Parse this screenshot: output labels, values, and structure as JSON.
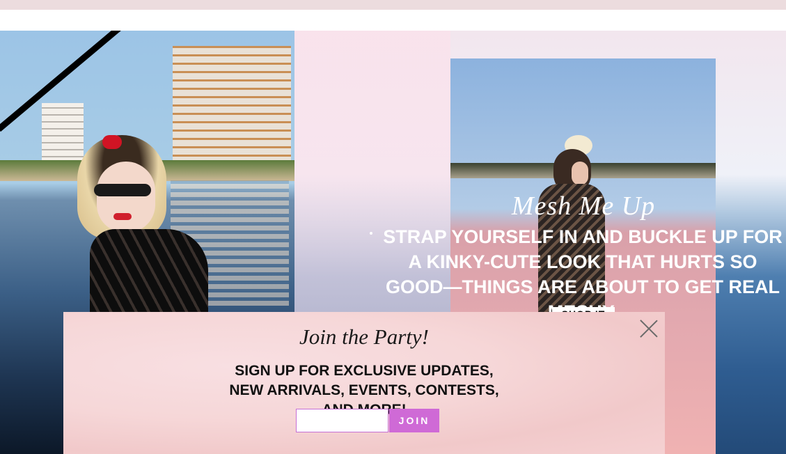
{
  "hero": {
    "title": "Mesh Me Up",
    "description": "STRAP YOURSELF IN AND BUCKLE UP FOR A KINKY-CUTE LOOK THAT HURTS SO GOOD—THINGS ARE ABOUT TO GET REAL MESHY.",
    "shop_button": "SHOP IT"
  },
  "signup_modal": {
    "title": "Join the Party!",
    "subtitle": "SIGN UP FOR EXCLUSIVE UPDATES, NEW ARRIVALS, EVENTS, CONTESTS, AND MORE!",
    "email_placeholder": "",
    "join_button": "JOIN",
    "close_icon": "close-icon"
  },
  "colors": {
    "top_bar": "#ecdcde",
    "join_button": "#cf6ad6",
    "input_border": "#c66fd6",
    "modal_background": "#f6d7d8"
  }
}
